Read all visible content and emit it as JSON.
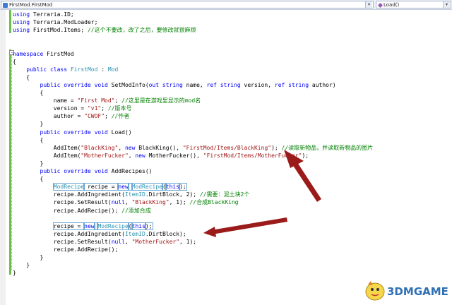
{
  "nav": {
    "left_combo": "FirstMod.FirstMod",
    "right_combo": "Load()"
  },
  "code": [
    {
      "parts": [
        {
          "c": "kw",
          "t": "using"
        },
        {
          "t": " Terraria.ID;"
        }
      ]
    },
    {
      "parts": [
        {
          "c": "kw",
          "t": "using"
        },
        {
          "t": " Terraria.ModLoader;"
        }
      ]
    },
    {
      "parts": [
        {
          "c": "kw",
          "t": "using"
        },
        {
          "t": " FirstMod.Items; "
        },
        {
          "c": "cm",
          "t": "//这个不要改，改了之后，要修改就很麻烦"
        }
      ]
    },
    {
      "parts": []
    },
    {
      "parts": []
    },
    {
      "parts": [
        {
          "c": "kw",
          "t": "namespace"
        },
        {
          "t": " FirstMod"
        }
      ]
    },
    {
      "parts": [
        {
          "t": "{"
        }
      ]
    },
    {
      "parts": [
        {
          "t": "    "
        },
        {
          "c": "kw",
          "t": "public class"
        },
        {
          "t": " "
        },
        {
          "c": "ty",
          "t": "FirstMod"
        },
        {
          "t": " : "
        },
        {
          "c": "ty",
          "t": "Mod"
        }
      ]
    },
    {
      "parts": [
        {
          "t": "    {"
        }
      ]
    },
    {
      "parts": [
        {
          "t": "        "
        },
        {
          "c": "kw",
          "t": "public override void"
        },
        {
          "t": " SetModInfo("
        },
        {
          "c": "kw",
          "t": "out string"
        },
        {
          "t": " name, "
        },
        {
          "c": "kw",
          "t": "ref string"
        },
        {
          "t": " version, "
        },
        {
          "c": "kw",
          "t": "ref string"
        },
        {
          "t": " author)"
        }
      ]
    },
    {
      "parts": [
        {
          "t": "        {"
        }
      ]
    },
    {
      "parts": [
        {
          "t": "            name = "
        },
        {
          "c": "str",
          "t": "\"First Mod\""
        },
        {
          "t": "; "
        },
        {
          "c": "cm",
          "t": "//这里是在游戏里显示的mod名"
        }
      ]
    },
    {
      "parts": [
        {
          "t": "            version = "
        },
        {
          "c": "str",
          "t": "\"v1\""
        },
        {
          "t": "; "
        },
        {
          "c": "cm",
          "t": "//版本号"
        }
      ]
    },
    {
      "parts": [
        {
          "t": "            author = "
        },
        {
          "c": "str",
          "t": "\"CWOF\""
        },
        {
          "t": "; "
        },
        {
          "c": "cm",
          "t": "//作者"
        }
      ]
    },
    {
      "parts": [
        {
          "t": "        }"
        }
      ]
    },
    {
      "parts": [
        {
          "t": "        "
        },
        {
          "c": "kw",
          "t": "public override void"
        },
        {
          "t": " Load()"
        }
      ]
    },
    {
      "parts": [
        {
          "t": "        {"
        }
      ]
    },
    {
      "parts": [
        {
          "t": "            AddItem("
        },
        {
          "c": "str",
          "t": "\"BlackKing\""
        },
        {
          "t": ", "
        },
        {
          "c": "kw",
          "t": "new"
        },
        {
          "t": " BlackKing(), "
        },
        {
          "c": "str",
          "t": "\"FirstMod/Items/BlackKing\""
        },
        {
          "t": "); "
        },
        {
          "c": "cm",
          "t": "//读取新物品，并读取新物品的图片"
        }
      ]
    },
    {
      "parts": [
        {
          "t": "            AddItem("
        },
        {
          "c": "str",
          "t": "\"MotherFucker\""
        },
        {
          "t": ", "
        },
        {
          "c": "kw",
          "t": "new"
        },
        {
          "t": " MotherFucker(), "
        },
        {
          "c": "str",
          "t": "\"FirstMod/Items/MotherFucker\""
        },
        {
          "t": ");"
        }
      ]
    },
    {
      "parts": [
        {
          "t": "        }"
        }
      ]
    },
    {
      "parts": [
        {
          "t": "        "
        },
        {
          "c": "kw",
          "t": "public override void"
        },
        {
          "t": " AddRecipes()"
        }
      ]
    },
    {
      "parts": [
        {
          "t": "        {"
        }
      ]
    },
    {
      "parts": [
        {
          "t": "            "
        },
        {
          "c": "ty hl",
          "t": "ModRecipe"
        },
        {
          "c": "hl",
          "t": " recipe = "
        },
        {
          "c": "kw hl",
          "t": "new"
        },
        {
          "c": "hl",
          "t": " "
        },
        {
          "c": "ty hl",
          "t": "ModRecipe"
        },
        {
          "c": "hl",
          "t": "("
        },
        {
          "c": "kw hl",
          "t": "this"
        },
        {
          "c": "hl",
          "t": ");"
        }
      ]
    },
    {
      "parts": [
        {
          "t": "            recipe.AddIngredient("
        },
        {
          "c": "ty",
          "t": "ItemID"
        },
        {
          "t": ".DirtBlock, 2); "
        },
        {
          "c": "cm",
          "t": "//需要：泥土块2个"
        }
      ]
    },
    {
      "parts": [
        {
          "t": "            recipe.SetResult("
        },
        {
          "c": "kw",
          "t": "null"
        },
        {
          "t": ", "
        },
        {
          "c": "str",
          "t": "\"BlackKing\""
        },
        {
          "t": ", 1); "
        },
        {
          "c": "cm",
          "t": "//合成BlackKing"
        }
      ]
    },
    {
      "parts": [
        {
          "t": "            recipe.AddRecipe(); "
        },
        {
          "c": "cm",
          "t": "//添加合成"
        }
      ]
    },
    {
      "parts": []
    },
    {
      "parts": [
        {
          "t": "            "
        },
        {
          "c": "hl",
          "t": "recipe = "
        },
        {
          "c": "kw hl",
          "t": "new"
        },
        {
          "c": "hl",
          "t": " "
        },
        {
          "c": "ty hl",
          "t": "ModRecipe"
        },
        {
          "c": "hl",
          "t": "("
        },
        {
          "c": "kw hl",
          "t": "this"
        },
        {
          "c": "hl",
          "t": ");"
        }
      ]
    },
    {
      "parts": [
        {
          "t": "            recipe.AddIngredient("
        },
        {
          "c": "ty",
          "t": "ItemID"
        },
        {
          "t": ".DirtBlock);"
        }
      ]
    },
    {
      "parts": [
        {
          "t": "            recipe.SetResult("
        },
        {
          "c": "kw",
          "t": "null"
        },
        {
          "t": ", "
        },
        {
          "c": "str",
          "t": "\"MotherFucker\""
        },
        {
          "t": ", 1);"
        }
      ]
    },
    {
      "parts": [
        {
          "t": "            recipe.AddRecipe();"
        }
      ]
    },
    {
      "parts": [
        {
          "t": "        }"
        }
      ]
    },
    {
      "parts": [
        {
          "t": "    }"
        }
      ]
    },
    {
      "parts": [
        {
          "t": "}"
        }
      ]
    }
  ],
  "watermark": {
    "text": "3DMGAME"
  },
  "colors": {
    "keyword": "#0000ff",
    "type": "#2b91af",
    "string": "#a31515",
    "comment": "#008000",
    "arrow": "#9b1b1b"
  }
}
